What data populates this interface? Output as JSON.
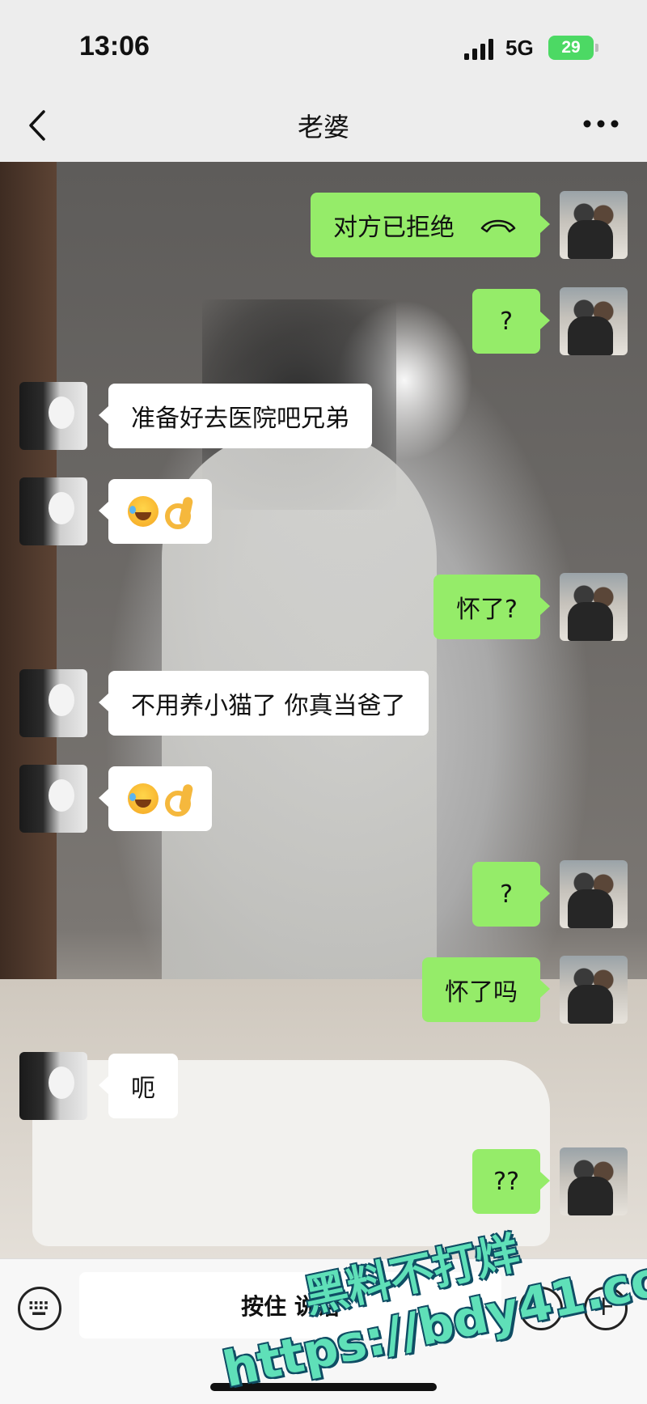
{
  "status_bar": {
    "time": "13:06",
    "network": "5G",
    "battery": "29"
  },
  "nav": {
    "title": "老婆",
    "back_icon": "chevron-left-icon",
    "more_icon": "more-dots-icon"
  },
  "messages": [
    {
      "side": "self",
      "text": "对方已拒绝",
      "type": "call",
      "icon": "phone-hangup-icon"
    },
    {
      "side": "self",
      "text": "?"
    },
    {
      "side": "other",
      "text": "准备好去医院吧兄弟"
    },
    {
      "side": "other",
      "type": "emoji",
      "text": "",
      "emojis": [
        "laugh-cry",
        "ok-hand"
      ]
    },
    {
      "side": "self",
      "text": "怀了?"
    },
    {
      "side": "other",
      "text": "不用养小猫了 你真当爸了"
    },
    {
      "side": "other",
      "type": "emoji",
      "text": "",
      "emojis": [
        "laugh-cry",
        "ok-hand"
      ]
    },
    {
      "side": "self",
      "text": "?"
    },
    {
      "side": "self",
      "text": "怀了吗"
    },
    {
      "side": "other",
      "text": "呃"
    },
    {
      "side": "self",
      "text": "??"
    }
  ],
  "input_bar": {
    "hold_to_talk": "按住 说话"
  },
  "watermark": {
    "line1": "黑料不打烊",
    "line2": "https://bdy41.co"
  },
  "colors": {
    "self_bubble": "#95ec69",
    "other_bubble": "#ffffff",
    "background": "#ededed"
  }
}
